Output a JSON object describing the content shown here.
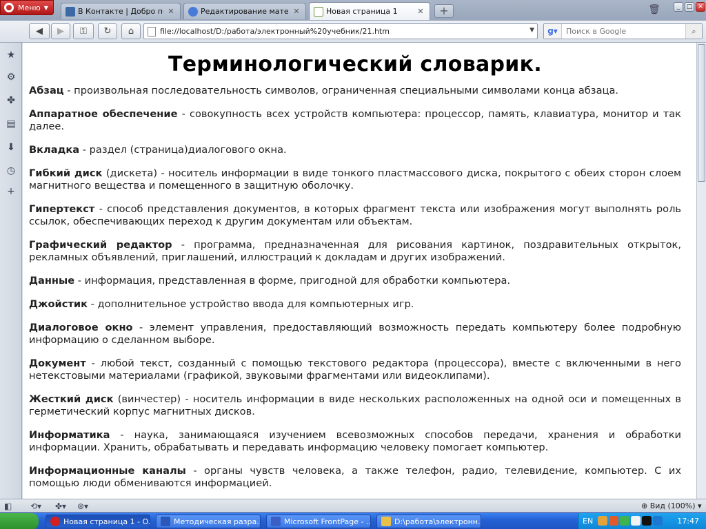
{
  "browser": {
    "menu_label": "Меню",
    "tabs": [
      {
        "title": "В Контакте | Добро по...",
        "favicon": "vk-icon",
        "color": "#3d6aa6"
      },
      {
        "title": "Редактирование матер...",
        "favicon": "edit-icon",
        "color": "#4a7ad8"
      },
      {
        "title": "Новая страница 1",
        "favicon": "page-icon",
        "color": "#6c9a3a",
        "active": true
      }
    ],
    "new_tab_symbol": "+",
    "address": "file://localhost/D:/работа/электронный%20учебник/21.htm",
    "search_placeholder": "Поиск в Google",
    "zoom": "Вид (100%)"
  },
  "page": {
    "title": "Терминологический словарик.",
    "terms": [
      {
        "term": "Абзац",
        "definition": " - произвольная последовательность символов, ограниченная специальными символами конца абзаца."
      },
      {
        "term": "Аппаратное обеспечение",
        "definition": " - совокупность всех устройств компьютера: процессор, память, клавиатура, монитор и так далее."
      },
      {
        "term": "Вкладка",
        "definition": " - раздел (страница)диалогового окна."
      },
      {
        "term": "Гибкий диск",
        "definition": " (дискета) - носитель информации в виде тонкого пластмассового диска, покрытого с обеих сторон слоем магнитного вещества и помещенного в защитную оболочку."
      },
      {
        "term": "Гипертекст",
        "definition": " - способ представления документов, в которых фрагмент текста или изображения могут выполнять роль ссылок, обеспечивающих переход к другим документам или объектам."
      },
      {
        "term": "Графический редактор",
        "definition": " - программа, предназначенная для рисования картинок, поздравительных открыток, рекламных объявлений, приглашений, иллюстраций к докладам и других изображений."
      },
      {
        "term": "Данные",
        "definition": " - информация, представленная в форме, пригодной для обработки компьютера."
      },
      {
        "term": "Джойстик",
        "definition": " - дополнительное устройство ввода для компьютерных игр."
      },
      {
        "term": "Диалоговое окно",
        "definition": " - элемент управления, предоставляющий возможность передать компьютеру более подробную информацию о сделанном выборе."
      },
      {
        "term": "Документ",
        "definition": " - любой текст, созданный с помощью текстового редактора (процессора), вместе с включенными в него нетекстовыми материалами (графикой, звуковыми фрагментами или видеоклипами)."
      },
      {
        "term": "Жесткий диск",
        "definition": " (винчестер) - носитель информации в виде нескольких расположенных на одной оси и помещенных в герметический корпус магнитных дисков."
      },
      {
        "term": "Информатика",
        "definition": " - наука, занимающаяся изучением всевозможных способов передачи, хранения и обработки информации. Хранить, обрабатывать и передавать информацию человеку помогает компьютер."
      },
      {
        "term": "Информационные каналы",
        "definition": " - органы чувств человека, а также телефон, радио, телевидение, компьютер. С их помощью люди обмениваются информацией."
      }
    ]
  },
  "taskbar": {
    "tasks": [
      {
        "label": "Новая страница 1 - O...",
        "icon_color": "#d42020",
        "active": true
      },
      {
        "label": "Методическая разра...",
        "icon_color": "#2b57b8"
      },
      {
        "label": "Microsoft FrontPage - ...",
        "icon_color": "#3a5fc6"
      },
      {
        "label": "D:\\работа\\электронн...",
        "icon_color": "#e8c04a"
      }
    ],
    "language": "EN",
    "clock": "17:47",
    "tray_colors": [
      "#e3a23a",
      "#e05a2a",
      "#3fb34f",
      "#f2f2f2",
      "#111111",
      "#1c77d2"
    ]
  }
}
